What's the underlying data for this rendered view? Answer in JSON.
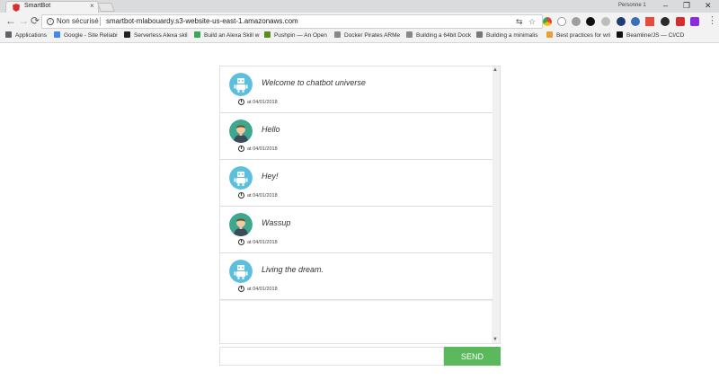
{
  "browser": {
    "tab_title": "SmartBot",
    "tab_close": "×",
    "profile_name": "Personne 1",
    "window_controls": [
      "–",
      "❐",
      "✕"
    ],
    "nav": {
      "back": "←",
      "forward": "→",
      "reload": "⟳"
    },
    "security_label": "Non sécurisé",
    "url": "smartbot-mlabouardy.s3-website-us-east-1.amazonaws.com",
    "translate_icon": "translate-icon",
    "star_icon": "☆",
    "menu_icon": "⋮",
    "bookmarks": [
      {
        "label": "Applications",
        "icon": "apps-grid-icon",
        "color": "#5f6368"
      },
      {
        "label": "Google - Site Reliabi",
        "icon": "google-icon",
        "color": "#4285f4"
      },
      {
        "label": "Serverless Alexa skil",
        "icon": "heart-icon",
        "color": "#222222"
      },
      {
        "label": "Build an Alexa Skill w",
        "icon": "leaf-icon",
        "color": "#3aa757"
      },
      {
        "label": "Pushpin — An Open",
        "icon": "pushpin-icon",
        "color": "#5b8c1f"
      },
      {
        "label": "Docker Pirates ARMe",
        "icon": "page-icon",
        "color": "#888888"
      },
      {
        "label": "Building a 64bit Dock",
        "icon": "page-icon",
        "color": "#888888"
      },
      {
        "label": "Building a minimalis",
        "icon": "waves-icon",
        "color": "#777777"
      },
      {
        "label": "Best practices for wri",
        "icon": "flower-icon",
        "color": "#e8a03a"
      },
      {
        "label": "Beamline/JS — CI/CD",
        "icon": "medium-icon",
        "color": "#111111"
      }
    ]
  },
  "chat": {
    "messages": [
      {
        "sender": "bot",
        "text": "Welcome to chatbot universe",
        "timestamp": "at 04/01/2018"
      },
      {
        "sender": "user",
        "text": "Hello",
        "timestamp": "at 04/01/2018"
      },
      {
        "sender": "bot",
        "text": "Hey!",
        "timestamp": "at 04/01/2018"
      },
      {
        "sender": "user",
        "text": "Wassup",
        "timestamp": "at 04/01/2018"
      },
      {
        "sender": "bot",
        "text": "Living the dream.",
        "timestamp": "at 04/01/2018"
      }
    ],
    "input": {
      "value": "",
      "placeholder": ""
    },
    "send_label": "SEND"
  },
  "colors": {
    "send_button": "#5cb85c",
    "bot_avatar_bg": "#5bc0de",
    "user_avatar_bg": "#3ca88f"
  }
}
